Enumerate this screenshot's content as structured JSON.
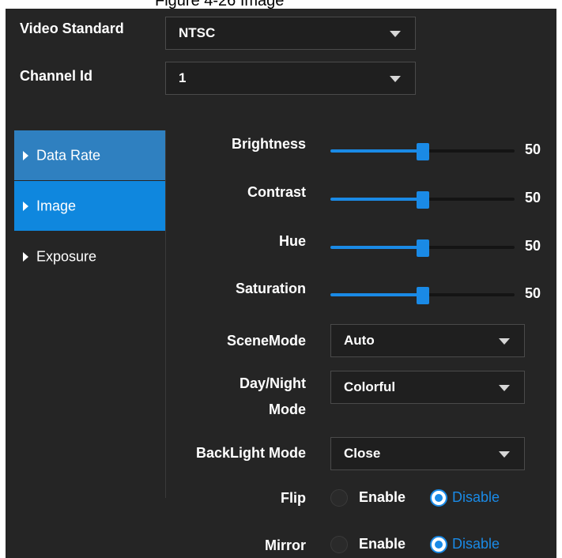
{
  "caption": "Figure 4-26 Image",
  "top_fields": {
    "video_standard": {
      "label": "Video Standard",
      "value": "NTSC"
    },
    "channel_id": {
      "label": "Channel Id",
      "value": "1"
    }
  },
  "nav": {
    "items": [
      {
        "label": "Data Rate",
        "state": "hover"
      },
      {
        "label": "Image",
        "state": "selected"
      },
      {
        "label": "Exposure",
        "state": "normal"
      }
    ]
  },
  "sliders": [
    {
      "label": "Brightness",
      "value": 50,
      "max": 100
    },
    {
      "label": "Contrast",
      "value": 50,
      "max": 100
    },
    {
      "label": "Hue",
      "value": 50,
      "max": 100
    },
    {
      "label": "Saturation",
      "value": 50,
      "max": 100
    }
  ],
  "selects": {
    "scene_mode": {
      "label": "SceneMode",
      "value": "Auto"
    },
    "day_night_mode": {
      "label_line1": "Day/Night",
      "label_line2": "Mode",
      "value": "Colorful"
    },
    "backlight_mode": {
      "label": "BackLight Mode",
      "value": "Close"
    }
  },
  "radios": {
    "flip": {
      "label": "Flip",
      "enable_label": "Enable",
      "disable_label": "Disable",
      "selected": "Disable"
    },
    "mirror": {
      "label": "Mirror",
      "enable_label": "Enable",
      "disable_label": "Disable",
      "selected": "Disable"
    }
  },
  "colors": {
    "background": "#252525",
    "accent": "#1a8ae6",
    "nav_selected": "#0f87de",
    "nav_hover": "#2f80c0",
    "track": "#141414"
  }
}
